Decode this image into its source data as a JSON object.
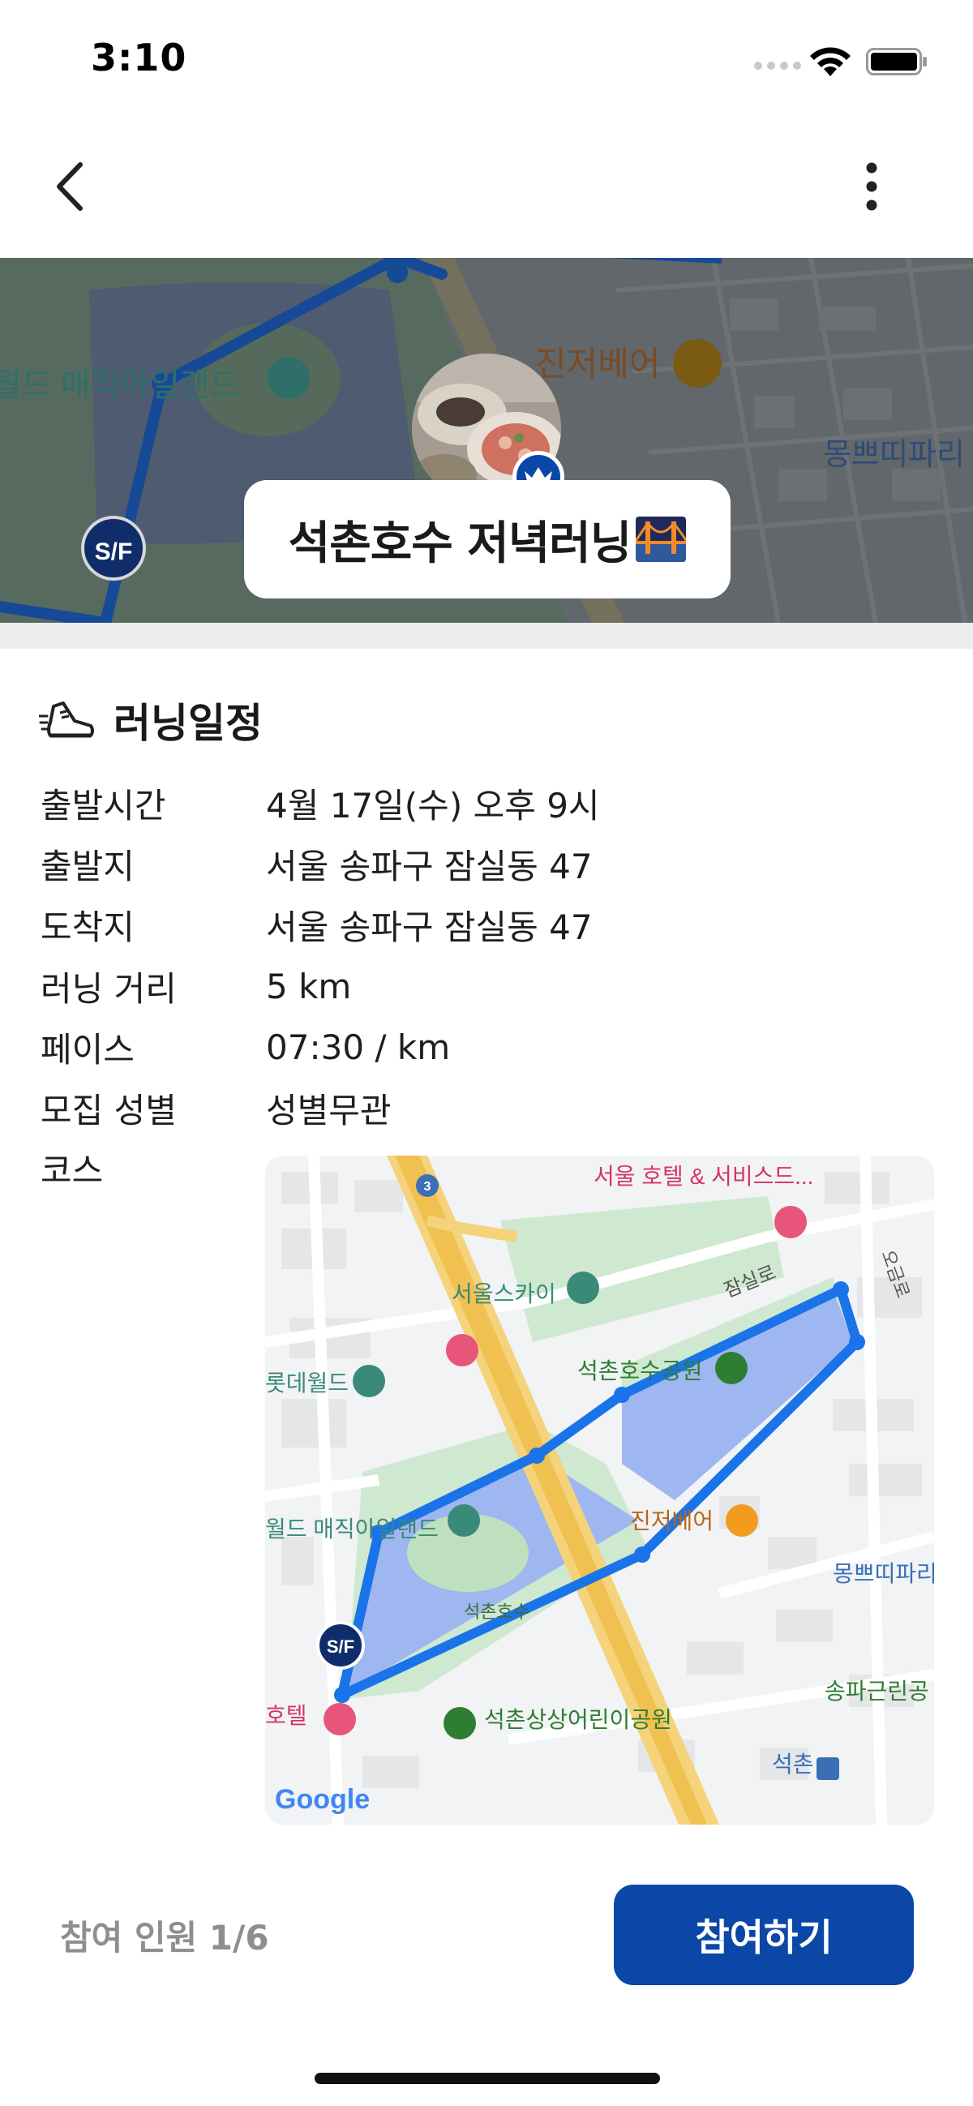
{
  "status_bar": {
    "time": "3:10"
  },
  "nav": {
    "back_icon": "chevron-left-icon",
    "more_icon": "more-vertical-icon"
  },
  "hero": {
    "map_labels": [
      "월드 매직아일랜드",
      "진저베어",
      "몽쁘띠파리"
    ],
    "marker_text": "S/F",
    "title": "석촌호수 저녁러닝",
    "host_badge_icon": "crown-icon"
  },
  "schedule": {
    "section_icon": "running-shoe-icon",
    "section_title": "러닝일정",
    "rows": [
      {
        "label": "출발시간",
        "value": "4월 17일(수) 오후 9시"
      },
      {
        "label": "출발지",
        "value": "서울 송파구 잠실동 47"
      },
      {
        "label": "도착지",
        "value": "서울 송파구 잠실동 47"
      },
      {
        "label": "러닝 거리",
        "value": "5 km"
      },
      {
        "label": "페이스",
        "value": "07:30 / km"
      },
      {
        "label": "모집 성별",
        "value": "성별무관"
      }
    ],
    "course_label": "코스"
  },
  "course_map": {
    "labels": {
      "hotel_top": "서울 호텔 & 서비스드...",
      "seoul_sky": "서울스카이",
      "jamsil_ro": "잠실로",
      "ogeum_ro": "오금로",
      "lotte_world": "롯데월드",
      "seokchon_park": "석촌호수공원",
      "magic_island": "월드 매직아일랜드",
      "ginger_bear": "진저베어",
      "mon_petit": "몽쁘띠파리",
      "seokchon_lake": "석촌호수",
      "hotel_bottom": "호텔",
      "kids_park": "석촌상상어린이공원",
      "songpa_park": "송파근린공",
      "seokchon_station": "석촌",
      "road_number": "3",
      "google": "Google",
      "marker_text": "S/F"
    }
  },
  "footer": {
    "participants": "참여 인원 1/6",
    "join_label": "참여하기"
  },
  "colors": {
    "brand": "#0b47a7",
    "route": "#1a73e8",
    "water": "#9fb7f0",
    "park": "#cfe8d0"
  }
}
